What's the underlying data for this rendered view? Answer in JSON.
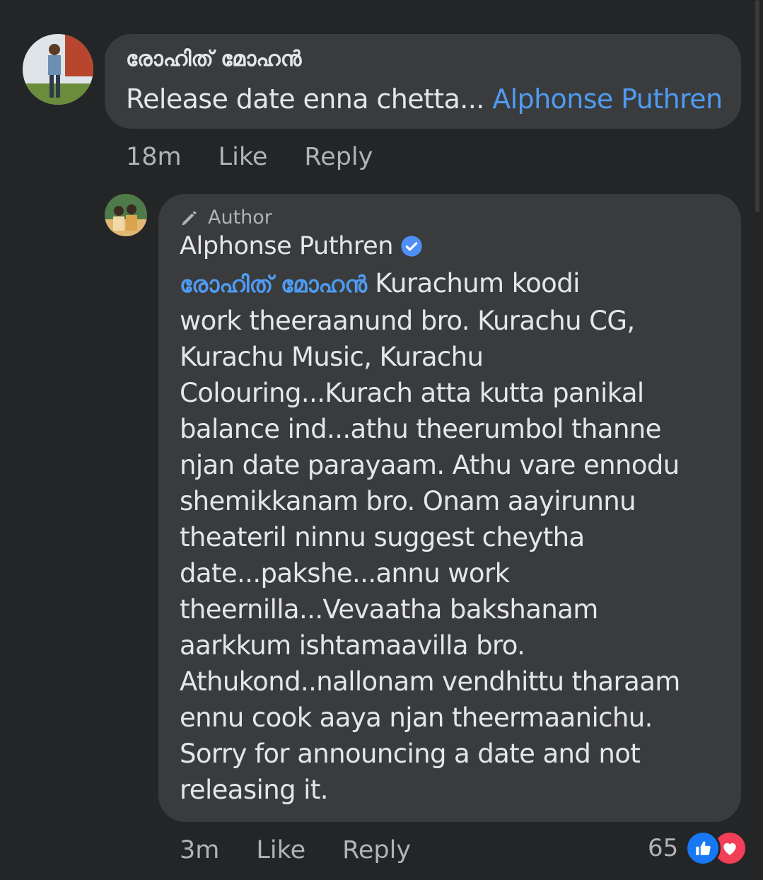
{
  "comment": {
    "author": "രോഹിത് മോഹൻ",
    "text": "Release date enna chetta...",
    "mention": "Alphonse Puthren",
    "time": "18m",
    "like_label": "Like",
    "reply_label": "Reply"
  },
  "reply": {
    "badge": "Author",
    "author": "Alphonse Puthren",
    "mention": "രോഹിത് മോഹൻ",
    "lines": [
      " Kurachum koodi",
      "work theeraanund bro. Kurachu CG,",
      "Kurachu Music, Kurachu",
      "Colouring...Kurach atta kutta panikal",
      "balance ind...athu theerumbol thanne",
      "njan date parayaam. Athu vare ennodu",
      "shemikkanam bro. Onam aayirunnu",
      "theateril ninnu suggest cheytha",
      "date...pakshe...annu work",
      "theernilla...Vevaatha bakshanam",
      "aarkkum ishtamaavilla bro.",
      "Athukond..nallonam vendhittu tharaam",
      "ennu cook aaya njan theermaanichu.",
      "Sorry for announcing a date and not",
      "releasing it."
    ],
    "time": "3m",
    "like_label": "Like",
    "reply_label": "Reply",
    "reaction_count": "65",
    "reaction_icons": [
      "like-icon",
      "love-icon"
    ]
  },
  "colors": {
    "background": "#242526",
    "bubble": "#3a3b3c",
    "mention": "#4f9bf2",
    "secondary_text": "#b0b3b8",
    "like_blue": "#1877f2",
    "love_red": "#f33e58"
  }
}
